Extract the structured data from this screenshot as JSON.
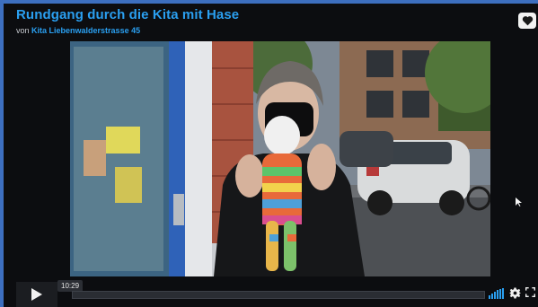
{
  "video_page": {
    "title": "Rundgang durch die Kita mit Hase",
    "byline_prefix": "von",
    "author": "Kita Liebenwalderstrasse 45"
  },
  "player": {
    "current_time": "10:29",
    "progress_fraction": 0.0
  },
  "icons": {
    "like": "heart-icon",
    "play": "play-icon",
    "volume": "volume-icon",
    "settings": "gear-icon",
    "fullscreen": "fullscreen-icon"
  },
  "colors": {
    "accent": "#2a9ff0",
    "background": "#0c0d10"
  }
}
